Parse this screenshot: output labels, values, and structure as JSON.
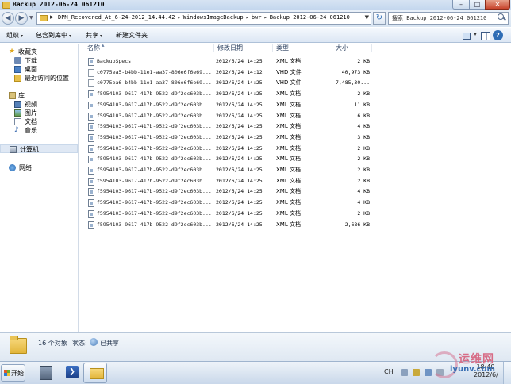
{
  "window": {
    "title": "Backup 2012-06-24 061210",
    "controls": {
      "minimize": "–",
      "maximize": "□",
      "close": "✕"
    }
  },
  "address": {
    "crumbs": [
      "DPM_Recovered_At_6-24-2012_14.44.42",
      "WindowsImageBackup",
      "bwr",
      "Backup 2012-06-24 061210"
    ],
    "separator": "▸",
    "search_text": "搜索 Backup 2012-06-24 061210"
  },
  "toolbar": {
    "organize": "组织",
    "include_in_library": "包含到库中",
    "share": "共享",
    "new_folder": "新建文件夹",
    "dropdown_arrow": "▾"
  },
  "nav": {
    "favorites": "收藏夹",
    "downloads": "下载",
    "desktop": "桌面",
    "recent": "最近访问的位置",
    "libraries": "库",
    "videos": "视频",
    "pictures": "图片",
    "documents": "文档",
    "music": "音乐",
    "computer": "计算机",
    "network": "网络"
  },
  "columns": {
    "name": "名称",
    "date": "修改日期",
    "type": "类型",
    "size": "大小"
  },
  "files": [
    {
      "name": "BackupSpecs",
      "date": "2012/6/24 14:25",
      "type": "XML 文档",
      "size": "2 KB",
      "kind": "xml"
    },
    {
      "name": "c0775ea5-b4bb-11e1-aa37-806e6f6e69...",
      "date": "2012/6/24 14:12",
      "type": "VHD 文件",
      "size": "40,973 KB",
      "kind": "vhd"
    },
    {
      "name": "c0775ea6-b4bb-11e1-aa37-806e6f6e69...",
      "date": "2012/6/24 14:25",
      "type": "VHD 文件",
      "size": "7,485,30...",
      "kind": "vhd"
    },
    {
      "name": "f5954103-9617-417b-9522-d9f2ec603b...",
      "date": "2012/6/24 14:25",
      "type": "XML 文档",
      "size": "2 KB",
      "kind": "xml"
    },
    {
      "name": "f5954103-9617-417b-9522-d9f2ec603b...",
      "date": "2012/6/24 14:25",
      "type": "XML 文档",
      "size": "11 KB",
      "kind": "xml"
    },
    {
      "name": "f5954103-9617-417b-9522-d9f2ec603b...",
      "date": "2012/6/24 14:25",
      "type": "XML 文档",
      "size": "6 KB",
      "kind": "xml"
    },
    {
      "name": "f5954103-9617-417b-9522-d9f2ec603b...",
      "date": "2012/6/24 14:25",
      "type": "XML 文档",
      "size": "4 KB",
      "kind": "xml"
    },
    {
      "name": "f5954103-9617-417b-9522-d9f2ec603b...",
      "date": "2012/6/24 14:25",
      "type": "XML 文档",
      "size": "3 KB",
      "kind": "xml"
    },
    {
      "name": "f5954103-9617-417b-9522-d9f2ec603b...",
      "date": "2012/6/24 14:25",
      "type": "XML 文档",
      "size": "2 KB",
      "kind": "xml"
    },
    {
      "name": "f5954103-9617-417b-9522-d9f2ec603b...",
      "date": "2012/6/24 14:25",
      "type": "XML 文档",
      "size": "2 KB",
      "kind": "xml"
    },
    {
      "name": "f5954103-9617-417b-9522-d9f2ec603b...",
      "date": "2012/6/24 14:25",
      "type": "XML 文档",
      "size": "2 KB",
      "kind": "xml"
    },
    {
      "name": "f5954103-9617-417b-9522-d9f2ec603b...",
      "date": "2012/6/24 14:25",
      "type": "XML 文档",
      "size": "2 KB",
      "kind": "xml"
    },
    {
      "name": "f5954103-9617-417b-9522-d9f2ec603b...",
      "date": "2012/6/24 14:25",
      "type": "XML 文档",
      "size": "4 KB",
      "kind": "xml"
    },
    {
      "name": "f5954103-9617-417b-9522-d9f2ec603b...",
      "date": "2012/6/24 14:25",
      "type": "XML 文档",
      "size": "4 KB",
      "kind": "xml"
    },
    {
      "name": "f5954103-9617-417b-9522-d9f2ec603b...",
      "date": "2012/6/24 14:25",
      "type": "XML 文档",
      "size": "2 KB",
      "kind": "xml"
    },
    {
      "name": "f5954103-9617-417b-9522-d9f2ec603b...",
      "date": "2012/6/24 14:25",
      "type": "XML 文档",
      "size": "2,686 KB",
      "kind": "xml"
    }
  ],
  "details": {
    "count": "16 个对象",
    "state_label": "状态:",
    "state_value": "已共享"
  },
  "taskbar": {
    "start": "开始",
    "lang": "CH",
    "clock_time": "18:40",
    "clock_date": "2012/6/"
  },
  "watermark": {
    "cn": "运维网",
    "en": "iyunv.com"
  }
}
